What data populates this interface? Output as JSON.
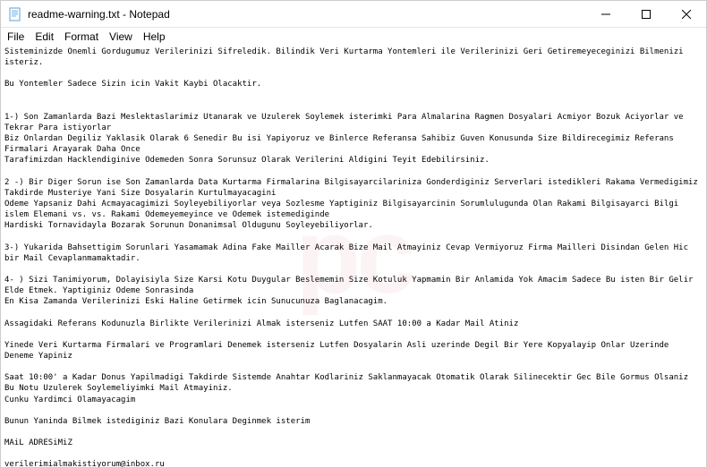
{
  "window": {
    "title": "readme-warning.txt - Notepad"
  },
  "menu": {
    "file": "File",
    "edit": "Edit",
    "format": "Format",
    "view": "View",
    "help": "Help"
  },
  "content": {
    "text": "Sisteminizde Onemli Gordugumuz Verilerinizi Sifreledik. Bilindik Veri Kurtarma Yontemleri ile Verilerinizi Geri Getiremeyeceginizi Bilmenizi isteriz.\n\nBu Yontemler Sadece Sizin icin Vakit Kaybi Olacaktir.\n\n\n1-) Son Zamanlarda Bazi Meslektaslarimiz Utanarak ve Uzulerek Soylemek isterimki Para Almalarina Ragmen Dosyalari Acmiyor Bozuk Aciyorlar ve Tekrar Para istiyorlar\nBiz Onlardan Degiliz Yaklasik Olarak 6 Senedir Bu isi Yapiyoruz ve Binlerce Referansa Sahibiz Guven Konusunda Size Bildirecegimiz Referans Firmalari Arayarak Daha Once\nTarafimizdan Hacklendiginive Odemeden Sonra Sorunsuz Olarak Verilerini Aldigini Teyit Edebilirsiniz.\n\n2 -) Bir Diger Sorun ise Son Zamanlarda Data Kurtarma Firmalarina Bilgisayarcilariniza Gonderdiginiz Serverlari istedikleri Rakama Vermedigimiz Takdirde Musteriye Yani Size Dosyalarin Kurtulmayacagini\nOdeme Yapsaniz Dahi Acmayacagimizi Soyleyebiliyorlar veya Sozlesme Yaptiginiz Bilgisayarcinin Sorumlulugunda Olan Rakami Bilgisayarci Bilgi islem Elemani vs. vs. Rakami Odemeyemeyince ve Odemek istemediginde\nHardiski Tornavidayla Bozarak Sorunun Donanimsal Oldugunu Soyleyebiliyorlar.\n\n3-) Yukarida Bahsettigim Sorunlari Yasamamak Adina Fake Mailler Acarak Bize Mail Atmayiniz Cevap Vermiyoruz Firma Mailleri Disindan Gelen Hic bir Mail Cevaplanmamaktadir.\n\n4- ) Sizi Tanimiyorum, Dolayisiyla Size Karsi Kotu Duygular Beslememin Size Kotuluk Yapmamin Bir Anlamida Yok Amacim Sadece Bu isten Bir Gelir Elde Etmek. Yaptiginiz Odeme Sonrasinda\nEn Kisa Zamanda Verilerinizi Eski Haline Getirmek icin Sunucunuza Baglanacagim.\n\nAssagidaki Referans Kodunuzla Birlikte Verilerinizi Almak isterseniz Lutfen SAAT 10:00 a Kadar Mail Atiniz\n\nYinede Veri Kurtarma Firmalari ve Programlari Denemek isterseniz Lutfen Dosyalarin Asli uzerinde Degil Bir Yere Kopyalayip Onlar Uzerinde Deneme Yapiniz\n\nSaat 10:00' a Kadar Donus Yapilmadigi Takdirde Sistemde Anahtar Kodlariniz Saklanmayacak Otomatik Olarak Silinecektir Gec Bile Gormus Olsaniz Bu Notu Uzulerek Soylemeliyimki Mail Atmayiniz.\nCunku Yardimci Olamayacagim\n\nBunun Yaninda Bilmek istediginiz Bazi Konulara Deginmek isterim\n\nMAiL ADRESiMiZ\n\nverilerimialmakistiyorum@inbox.ru"
  },
  "watermark": "pc"
}
